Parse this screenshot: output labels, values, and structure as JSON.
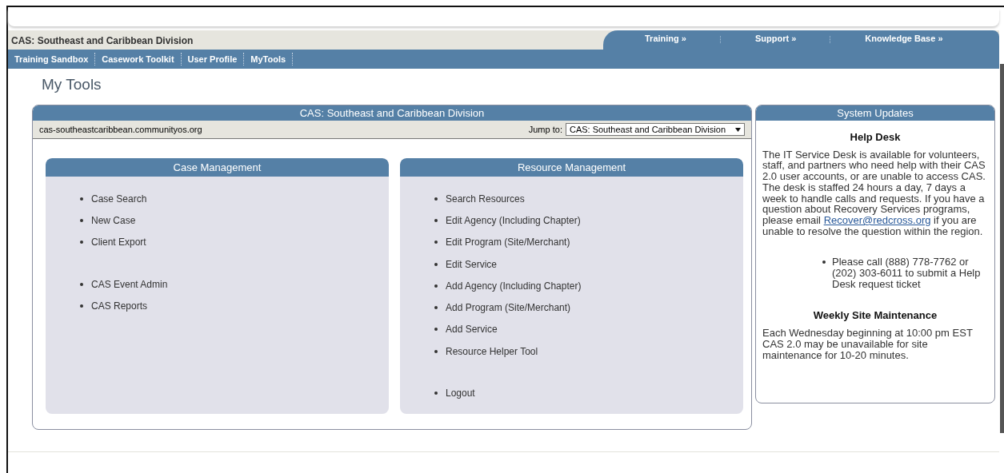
{
  "header": {
    "title": "CAS: Southeast and Caribbean Division",
    "top_links": [
      "Training »",
      "Support »",
      "Knowledge Base »"
    ]
  },
  "nav": [
    "Training Sandbox",
    "Casework Toolkit",
    "User Profile",
    "MyTools"
  ],
  "page_title": "My Tools",
  "main_panel": {
    "title": "CAS: Southeast and Caribbean Division",
    "site": "cas-southeastcaribbean.communityos.org",
    "jump_label": "Jump to:",
    "jump_value": "CAS: Southeast and Caribbean Division",
    "sections": [
      {
        "title": "Case Management",
        "groups": [
          [
            "Case Search",
            "New Case",
            "Client Export"
          ],
          [
            "CAS Event Admin",
            "CAS Reports"
          ]
        ]
      },
      {
        "title": "Resource Management",
        "groups": [
          [
            "Search Resources",
            "Edit Agency (Including Chapter)",
            "Edit Program (Site/Merchant)",
            "Edit Service",
            "Add Agency (Including Chapter)",
            "Add Program (Site/Merchant)",
            "Add Service",
            "Resource Helper Tool"
          ],
          [
            "Logout"
          ]
        ]
      }
    ]
  },
  "side_panel": {
    "title": "System Updates",
    "help_heading": "Help Desk",
    "help_text_before": "The IT Service Desk is available for volunteers, staff, and partners who need help with their CAS 2.0 user accounts, or are unable to access CAS. The desk is staffed 24 hours a day, 7 days a week to handle calls and requests. If you have a question about Recovery Services programs, please email",
    "help_link": "Recover@redcross.org",
    "help_text_after": "if you are unable to resolve the question within the region.",
    "help_bullets": [
      "Please call (888) 778-7762 or (202) 303-6011 to submit a Help Desk request ticket"
    ],
    "maint_heading": "Weekly Site Maintenance",
    "maint_text": "Each Wednesday beginning at 10:00 pm EST CAS 2.0 may be unavailable for site maintenance for 10-20 minutes."
  }
}
